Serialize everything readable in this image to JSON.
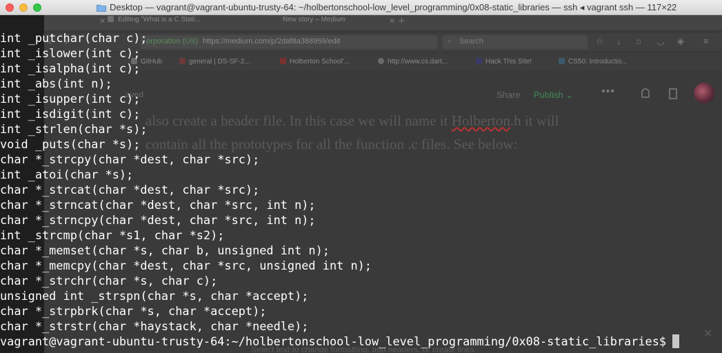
{
  "window": {
    "title": "Desktop — vagrant@vagrant-ubuntu-trusty-64: ~/holbertonschool-low_level_programming/0x08-static_libraries — ssh ◂ vagrant ssh — 117×22"
  },
  "background_browser": {
    "tabs": [
      {
        "label": "Editing \"What is a C Stati...",
        "close": "✕"
      },
      {
        "label": "New story – Medium",
        "close": "✕"
      }
    ],
    "new_tab": "+",
    "address": {
      "org": "orporation (US)",
      "url": "https://medium.com/p/2daf8a388959/edit"
    },
    "search_placeholder": "Search",
    "bookmarks": [
      "GitHub",
      "general | DS-SF-2...",
      "Holberton School'...",
      "http://www.cs.dart...",
      "Hack This Site!",
      "CS50: Introductio..."
    ],
    "saved_label": "aved",
    "share_label": "Share",
    "publish_label": "Publish ⌄",
    "more_label": "•••",
    "article": {
      "line1_a": "also create a header file. In this case we will name it ",
      "line1_b": "Holberton",
      "line1_c": ".h it will",
      "line2": "contain all the prototypes for all the function .c files. See below:"
    },
    "hint": "Select text to change formatting, add headers, or create links.",
    "close_glyph": "✕"
  },
  "terminal": {
    "lines": [
      "int _putchar(char c);",
      "int _islower(int c);",
      "int _isalpha(int c);",
      "int _abs(int n);",
      "int _isupper(int c);",
      "int _isdigit(int c);",
      "int _strlen(char *s);",
      "void _puts(char *s);",
      "char *_strcpy(char *dest, char *src);",
      "int _atoi(char *s);",
      "char *_strcat(char *dest, char *src);",
      "char *_strncat(char *dest, char *src, int n);",
      "char *_strncpy(char *dest, char *src, int n);",
      "int _strcmp(char *s1, char *s2);",
      "char *_memset(char *s, char b, unsigned int n);",
      "char *_memcpy(char *dest, char *src, unsigned int n);",
      "char *_strchr(char *s, char c);",
      "unsigned int _strspn(char *s, char *accept);",
      "char *_strpbrk(char *s, char *accept);",
      "char *_strstr(char *haystack, char *needle);"
    ],
    "prompt": "vagrant@vagrant-ubuntu-trusty-64:~/holbertonschool-low_level_programming/0x08-static_libraries$"
  }
}
